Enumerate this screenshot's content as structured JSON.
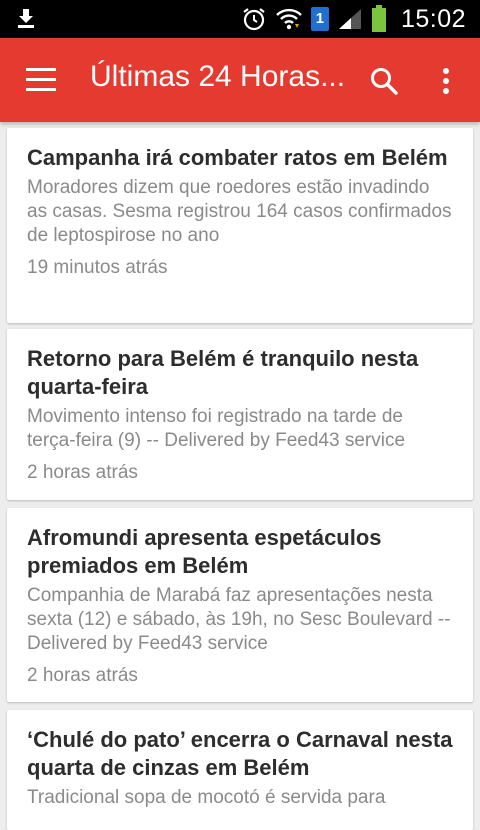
{
  "status_bar": {
    "time": "15:02",
    "sim_badge": "1",
    "icons": [
      "download-icon",
      "alarm-icon",
      "wifi-icon",
      "sim-icon",
      "signal-icon",
      "battery-icon"
    ],
    "battery_color": "#7cc33e"
  },
  "app_bar": {
    "title": "Últimas 24 Horas...",
    "color": "#e53a2f",
    "icons": [
      "menu-icon",
      "search-icon",
      "more-vert-icon"
    ]
  },
  "articles": [
    {
      "title": "Campanha irá combater ratos em Belém",
      "description": "Moradores dizem que roedores estão invadindo as casas. Sesma registrou 164 casos confirmados de leptospirose no ano",
      "time": "19 minutos atrás"
    },
    {
      "title": "Retorno para Belém é tranquilo nesta quarta-feira",
      "description": "Movimento intenso foi registrado na tarde de terça-feira (9) -- Delivered by Feed43 service",
      "time": "2 horas atrás"
    },
    {
      "title": "Afromundi apresenta espetáculos premiados em Belém",
      "description": "Companhia de Marabá faz apresentações nesta sexta (12) e sábado, às 19h, no Sesc Boulevard -- Delivered by Feed43 service",
      "time": "2 horas atrás"
    },
    {
      "title": "‘Chulé do pato’ encerra o Carnaval nesta quarta de cinzas em Belém",
      "description": "Tradicional sopa de mocotó é servida para",
      "time": ""
    }
  ]
}
